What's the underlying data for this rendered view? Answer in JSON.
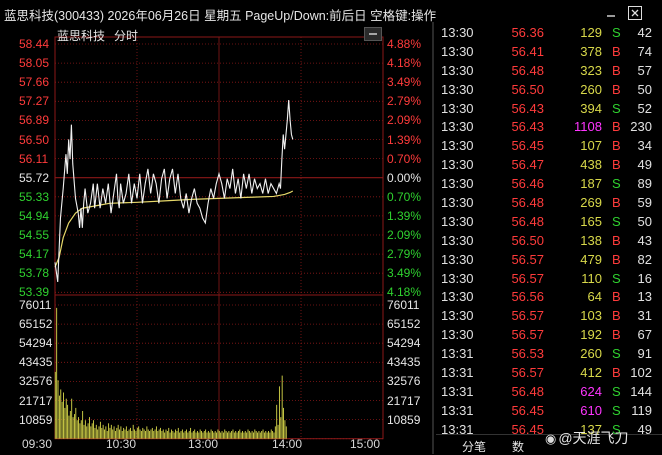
{
  "window": {
    "title": "蓝思科技(300433) 2026年06月26日 星期五 PageUp/Down:前后日 空格键:操作",
    "minimize_icon": "minimize-icon",
    "close_icon": "close-icon"
  },
  "chart_header": {
    "stock_name": "蓝思科技",
    "period": "分时"
  },
  "colors": {
    "up": "#ff3b3b",
    "down": "#2fd12f",
    "neutral": "#e6e6e6",
    "avg_line": "#e6d86a",
    "volume": "#d8d84a",
    "big_volume": "#ff35ff",
    "grid": "#8b1818"
  },
  "chart_data": {
    "type": "line",
    "prev_close": 55.72,
    "price_axis": [
      "58.44",
      "58.05",
      "57.66",
      "57.27",
      "56.89",
      "56.50",
      "56.11",
      "55.72",
      "55.33",
      "54.94",
      "54.55",
      "54.17",
      "53.78",
      "53.39"
    ],
    "pct_axis": [
      "4.88%",
      "4.18%",
      "3.49%",
      "2.79%",
      "2.09%",
      "1.39%",
      "0.70%",
      "0.00%",
      "0.70%",
      "1.39%",
      "2.09%",
      "2.79%",
      "3.49%",
      "4.18%"
    ],
    "volume_axis": [
      "76011",
      "65152",
      "54294",
      "43435",
      "32576",
      "21717",
      "10859"
    ],
    "x_ticks": [
      "09:30",
      "10:30",
      "13:00",
      "14:00",
      "15:00"
    ],
    "x_minutes": [
      0,
      240
    ],
    "price_series": [
      [
        0,
        54.0
      ],
      [
        2,
        53.6
      ],
      [
        4,
        54.9
      ],
      [
        6,
        55.5
      ],
      [
        8,
        56.2
      ],
      [
        9,
        55.8
      ],
      [
        10,
        56.5
      ],
      [
        11,
        56.1
      ],
      [
        12,
        56.8
      ],
      [
        13,
        56.0
      ],
      [
        15,
        55.3
      ],
      [
        17,
        55.0
      ],
      [
        18,
        54.7
      ],
      [
        19,
        55.1
      ],
      [
        20,
        54.7
      ],
      [
        21,
        55.2
      ],
      [
        22,
        55.5
      ],
      [
        24,
        55.0
      ],
      [
        26,
        55.2
      ],
      [
        28,
        55.6
      ],
      [
        29,
        55.1
      ],
      [
        31,
        55.6
      ],
      [
        33,
        55.1
      ],
      [
        35,
        55.5
      ],
      [
        37,
        55.2
      ],
      [
        39,
        55.6
      ],
      [
        41,
        55.0
      ],
      [
        43,
        55.4
      ],
      [
        45,
        55.8
      ],
      [
        46,
        55.3
      ],
      [
        47,
        55.1
      ],
      [
        48,
        55.6
      ],
      [
        50,
        55.2
      ],
      [
        52,
        55.4
      ],
      [
        54,
        55.8
      ],
      [
        56,
        55.2
      ],
      [
        58,
        55.6
      ],
      [
        60,
        55.3
      ],
      [
        62,
        55.8
      ],
      [
        64,
        55.2
      ],
      [
        66,
        55.6
      ],
      [
        68,
        55.9
      ],
      [
        70,
        55.4
      ],
      [
        72,
        55.8
      ],
      [
        74,
        55.6
      ],
      [
        76,
        55.2
      ],
      [
        78,
        55.7
      ],
      [
        80,
        55.9
      ],
      [
        82,
        55.3
      ],
      [
        84,
        55.7
      ],
      [
        86,
        55.9
      ],
      [
        88,
        55.4
      ],
      [
        90,
        55.8
      ],
      [
        92,
        55.3
      ],
      [
        94,
        55.1
      ],
      [
        96,
        55.4
      ],
      [
        98,
        55.0
      ],
      [
        100,
        55.3
      ],
      [
        102,
        55.5
      ],
      [
        104,
        55.2
      ],
      [
        106,
        55.1
      ],
      [
        108,
        54.9
      ],
      [
        110,
        54.8
      ],
      [
        112,
        55.2
      ],
      [
        114,
        55.5
      ],
      [
        116,
        55.3
      ],
      [
        118,
        55.6
      ],
      [
        120,
        55.8
      ],
      [
        122,
        55.6
      ],
      [
        124,
        55.3
      ],
      [
        126,
        55.7
      ],
      [
        128,
        55.5
      ],
      [
        130,
        55.9
      ],
      [
        132,
        55.4
      ],
      [
        134,
        55.7
      ],
      [
        136,
        55.3
      ],
      [
        138,
        55.8
      ],
      [
        140,
        55.5
      ],
      [
        142,
        55.8
      ],
      [
        144,
        55.4
      ],
      [
        146,
        55.7
      ],
      [
        148,
        55.5
      ],
      [
        150,
        55.6
      ],
      [
        152,
        55.4
      ],
      [
        154,
        55.7
      ],
      [
        156,
        55.4
      ],
      [
        158,
        55.6
      ],
      [
        160,
        55.5
      ],
      [
        162,
        55.4
      ],
      [
        164,
        55.6
      ],
      [
        165,
        55.5
      ],
      [
        166,
        56.1
      ],
      [
        167,
        56.6
      ],
      [
        168,
        56.3
      ],
      [
        169,
        56.6
      ],
      [
        170,
        56.9
      ],
      [
        171,
        57.3
      ],
      [
        172,
        56.9
      ],
      [
        173,
        56.6
      ],
      [
        174,
        56.5
      ]
    ],
    "avg_series": [
      [
        0,
        53.9
      ],
      [
        3,
        54.1
      ],
      [
        6,
        54.5
      ],
      [
        10,
        54.8
      ],
      [
        15,
        55.0
      ],
      [
        20,
        55.1
      ],
      [
        30,
        55.15
      ],
      [
        40,
        55.2
      ],
      [
        60,
        55.22
      ],
      [
        80,
        55.25
      ],
      [
        100,
        55.28
      ],
      [
        120,
        55.3
      ],
      [
        140,
        55.32
      ],
      [
        160,
        55.34
      ],
      [
        168,
        55.38
      ],
      [
        172,
        55.42
      ],
      [
        174,
        55.45
      ]
    ],
    "volume_max": 86870,
    "volume_bars": [
      43400,
      85000,
      38000,
      28000,
      32000,
      24000,
      30000,
      20000,
      26000,
      22000,
      15000,
      18000,
      26000,
      14000,
      16000,
      20000,
      12000,
      14000,
      10000,
      12000,
      18000,
      9000,
      12000,
      8000,
      10000,
      14000,
      8000,
      10000,
      12000,
      7000,
      9000,
      6000,
      8000,
      11000,
      7000,
      9000,
      6000,
      8000,
      5000,
      10000,
      7000,
      9000,
      6000,
      8000,
      5000,
      7000,
      9000,
      6000,
      8000,
      5000,
      7000,
      6000,
      8000,
      5000,
      6000,
      7000,
      5000,
      9000,
      6000,
      5000,
      7000,
      8000,
      6000,
      5000,
      7000,
      6000,
      5000,
      8000,
      6000,
      5000,
      6000,
      7000,
      5000,
      6000,
      8000,
      5000,
      6000,
      7000,
      5000,
      6000,
      4000,
      6000,
      5000,
      7000,
      4000,
      6000,
      5000,
      4000,
      6000,
      5000,
      7000,
      4000,
      5000,
      6000,
      4000,
      5000,
      6000,
      4000,
      5000,
      7000,
      4000,
      5000,
      6000,
      4000,
      5000,
      4000,
      6000,
      5000,
      4000,
      5000,
      6000,
      4000,
      5000,
      4000,
      6000,
      5000,
      4000,
      5000,
      4000,
      6000,
      5000,
      4000,
      5000,
      4000,
      6000,
      5000,
      4000,
      5000,
      4000,
      5000,
      6000,
      4000,
      5000,
      4000,
      5000,
      6000,
      4000,
      5000,
      4000,
      5000,
      4000,
      6000,
      5000,
      4000,
      5000,
      4000,
      6000,
      5000,
      4000,
      5000,
      4000,
      5000,
      6000,
      4000,
      5000,
      4000,
      5000,
      4000,
      6000,
      5000,
      4000,
      8000,
      22000,
      9000,
      34000,
      14000,
      41000,
      20000,
      12000,
      8000
    ]
  },
  "trades": [
    {
      "time": "13:30",
      "price": "56.36",
      "vol": "129",
      "side": "S",
      "count": "42"
    },
    {
      "time": "13:30",
      "price": "56.41",
      "vol": "378",
      "side": "B",
      "count": "74"
    },
    {
      "time": "13:30",
      "price": "56.48",
      "vol": "323",
      "side": "B",
      "count": "57"
    },
    {
      "time": "13:30",
      "price": "56.50",
      "vol": "260",
      "side": "B",
      "count": "50"
    },
    {
      "time": "13:30",
      "price": "56.43",
      "vol": "394",
      "side": "S",
      "count": "52"
    },
    {
      "time": "13:30",
      "price": "56.43",
      "vol": "1108",
      "side": "B",
      "count": "230",
      "big": true
    },
    {
      "time": "13:30",
      "price": "56.45",
      "vol": "107",
      "side": "B",
      "count": "34"
    },
    {
      "time": "13:30",
      "price": "56.47",
      "vol": "438",
      "side": "B",
      "count": "49"
    },
    {
      "time": "13:30",
      "price": "56.46",
      "vol": "187",
      "side": "S",
      "count": "89"
    },
    {
      "time": "13:30",
      "price": "56.48",
      "vol": "269",
      "side": "B",
      "count": "59"
    },
    {
      "time": "13:30",
      "price": "56.48",
      "vol": "165",
      "side": "S",
      "count": "50"
    },
    {
      "time": "13:30",
      "price": "56.50",
      "vol": "138",
      "side": "B",
      "count": "43"
    },
    {
      "time": "13:30",
      "price": "56.57",
      "vol": "479",
      "side": "B",
      "count": "82"
    },
    {
      "time": "13:30",
      "price": "56.57",
      "vol": "110",
      "side": "S",
      "count": "16"
    },
    {
      "time": "13:30",
      "price": "56.56",
      "vol": "64",
      "side": "B",
      "count": "13"
    },
    {
      "time": "13:30",
      "price": "56.57",
      "vol": "103",
      "side": "B",
      "count": "31"
    },
    {
      "time": "13:30",
      "price": "56.57",
      "vol": "192",
      "side": "B",
      "count": "67"
    },
    {
      "time": "13:31",
      "price": "56.53",
      "vol": "260",
      "side": "S",
      "count": "91"
    },
    {
      "time": "13:31",
      "price": "56.57",
      "vol": "412",
      "side": "B",
      "count": "102"
    },
    {
      "time": "13:31",
      "price": "56.48",
      "vol": "624",
      "side": "S",
      "count": "144",
      "big": true
    },
    {
      "time": "13:31",
      "price": "56.45",
      "vol": "610",
      "side": "S",
      "count": "119",
      "big": true
    },
    {
      "time": "13:31",
      "price": "56.45",
      "vol": "137",
      "side": "S",
      "count": "49"
    }
  ],
  "bottom_tabs": {
    "trades_tab": "分笔",
    "other_tab": "数"
  },
  "watermark": {
    "icon": "weibo-icon",
    "text": "@天涯飞刀"
  }
}
